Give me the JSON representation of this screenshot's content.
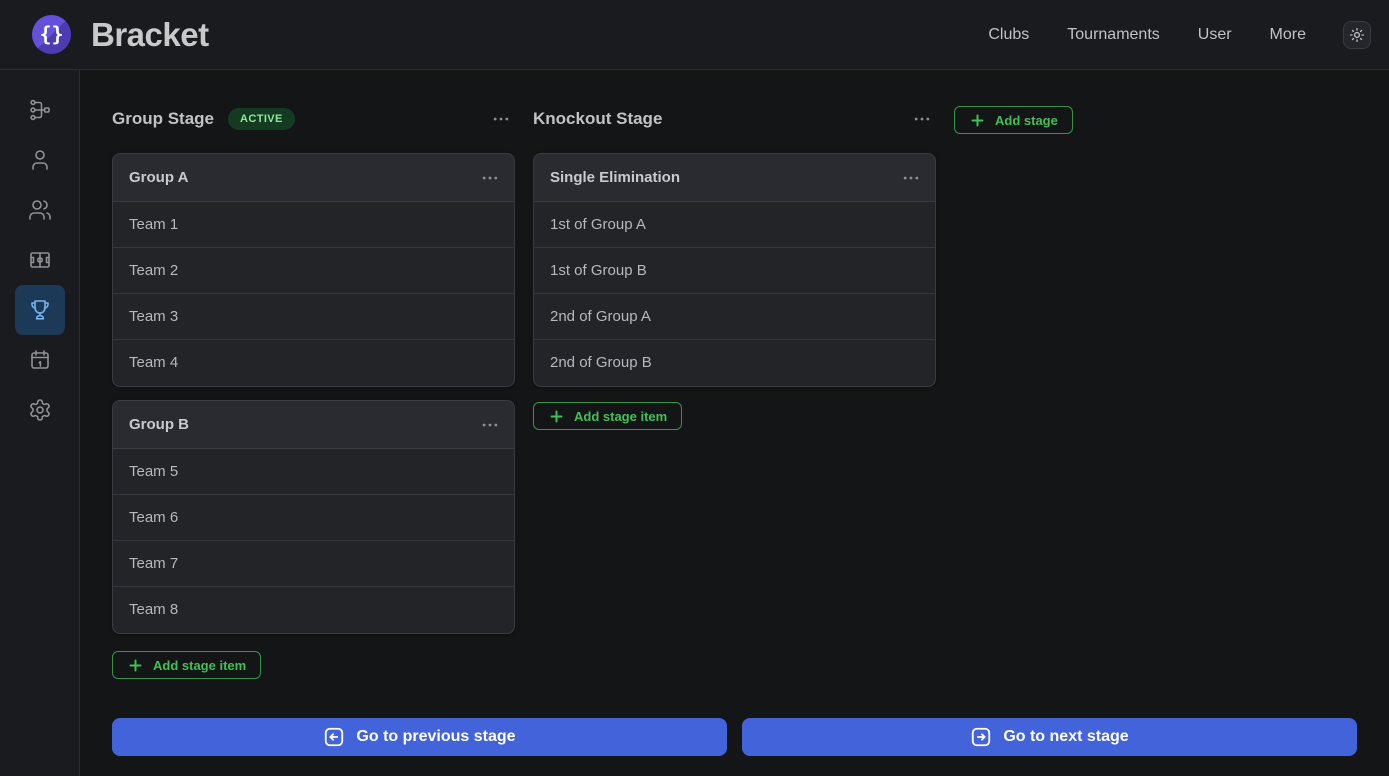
{
  "app": {
    "title": "Bracket",
    "logo_glyph": "{}"
  },
  "nav": {
    "items": [
      {
        "label": "Clubs"
      },
      {
        "label": "Tournaments"
      },
      {
        "label": "User"
      },
      {
        "label": "More"
      }
    ],
    "theme_toggle_icon": "sun-icon"
  },
  "sidebar": {
    "items": [
      {
        "icon": "flow-icon",
        "active": false
      },
      {
        "icon": "user-icon",
        "active": false
      },
      {
        "icon": "users-icon",
        "active": false
      },
      {
        "icon": "field-icon",
        "active": false
      },
      {
        "icon": "trophy-icon",
        "active": true
      },
      {
        "icon": "calendar-icon",
        "active": false
      },
      {
        "icon": "settings-icon",
        "active": false
      }
    ]
  },
  "group_stage": {
    "title": "Group Stage",
    "badge": "ACTIVE",
    "groups": [
      {
        "title": "Group A",
        "teams": [
          "Team 1",
          "Team 2",
          "Team 3",
          "Team 4"
        ]
      },
      {
        "title": "Group B",
        "teams": [
          "Team 5",
          "Team 6",
          "Team 7",
          "Team 8"
        ]
      }
    ],
    "add_item_label": "Add stage item"
  },
  "knockout_stage": {
    "title": "Knockout Stage",
    "brackets": [
      {
        "title": "Single Elimination",
        "slots": [
          "1st of Group A",
          "1st of Group B",
          "2nd of Group A",
          "2nd of Group B"
        ]
      }
    ],
    "add_item_label": "Add stage item"
  },
  "actions": {
    "add_stage_label": "Add stage",
    "previous_stage_label": "Go to previous stage",
    "next_stage_label": "Go to next stage"
  },
  "colors": {
    "page_bg": "#141517",
    "panel_bg": "#1a1b1e",
    "card_bg": "#232428",
    "accent_green": "#40c057",
    "badge_bg": "#143b22",
    "badge_text": "#8ce99a",
    "primary_blue": "#4363db",
    "brand_violet": "#5f45d2",
    "active_item_bg": "#1c3a57",
    "active_item_icon": "#74b3ef"
  }
}
